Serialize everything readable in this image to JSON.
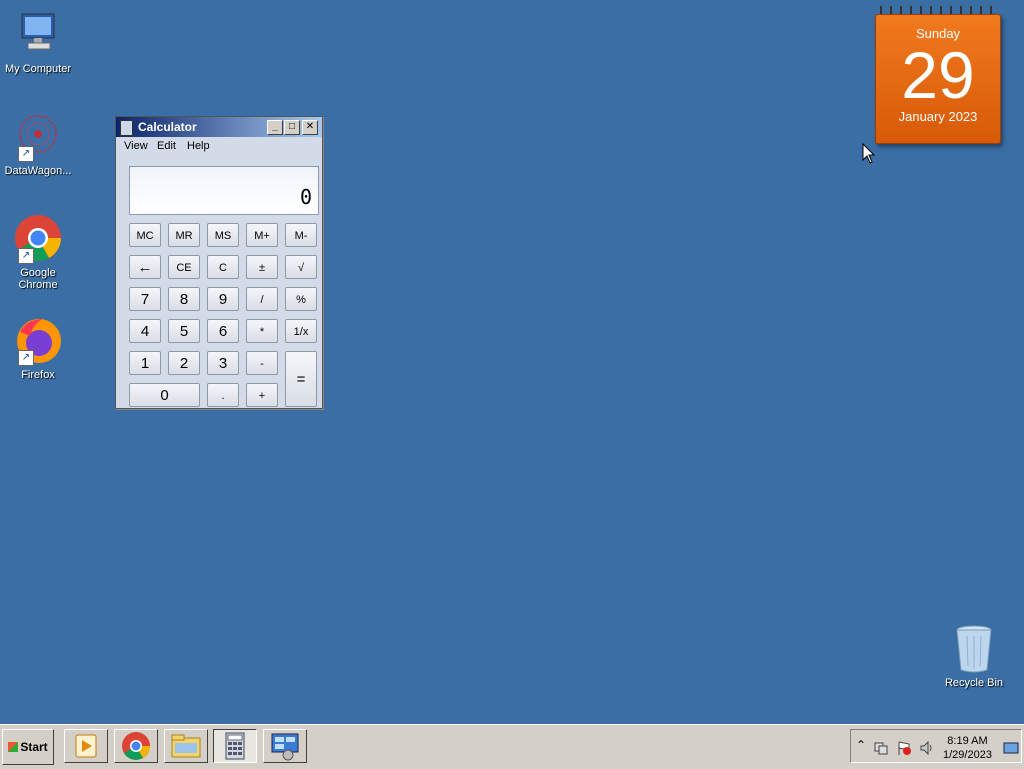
{
  "desktop": {
    "icons": [
      {
        "label": "My Computer",
        "icon": "computer-icon"
      },
      {
        "label": "DataWagon...",
        "icon": "datawagon-icon"
      },
      {
        "label": "Google Chrome",
        "icon": "chrome-icon"
      },
      {
        "label": "Firefox",
        "icon": "firefox-icon"
      },
      {
        "label": "Recycle Bin",
        "icon": "recycle-bin-icon"
      }
    ]
  },
  "calendar": {
    "weekday": "Sunday",
    "day": "29",
    "month_year": "January 2023",
    "color": "#e8680f"
  },
  "calculator": {
    "title": "Calculator",
    "window_buttons": {
      "minimize": "_",
      "maximize": "□",
      "close": "✕"
    },
    "menu": [
      "View",
      "Edit",
      "Help"
    ],
    "display": "0",
    "rows": [
      [
        "MC",
        "MR",
        "MS",
        "M+",
        "M-"
      ],
      [
        "←",
        "CE",
        "C",
        "±",
        "√"
      ],
      [
        "7",
        "8",
        "9",
        "/",
        "%"
      ],
      [
        "4",
        "5",
        "6",
        "*",
        "1/x"
      ],
      [
        "1",
        "2",
        "3",
        "-",
        "="
      ],
      [
        "0",
        ".",
        "+"
      ]
    ]
  },
  "taskbar": {
    "start_label": "Start",
    "apps": [
      "media-player-icon",
      "chrome-icon",
      "file-explorer-icon",
      "calculator-icon",
      "control-panel-icon"
    ],
    "clock_time": "8:19 AM",
    "clock_date": "1/29/2023",
    "tray_expand": "⌃"
  }
}
